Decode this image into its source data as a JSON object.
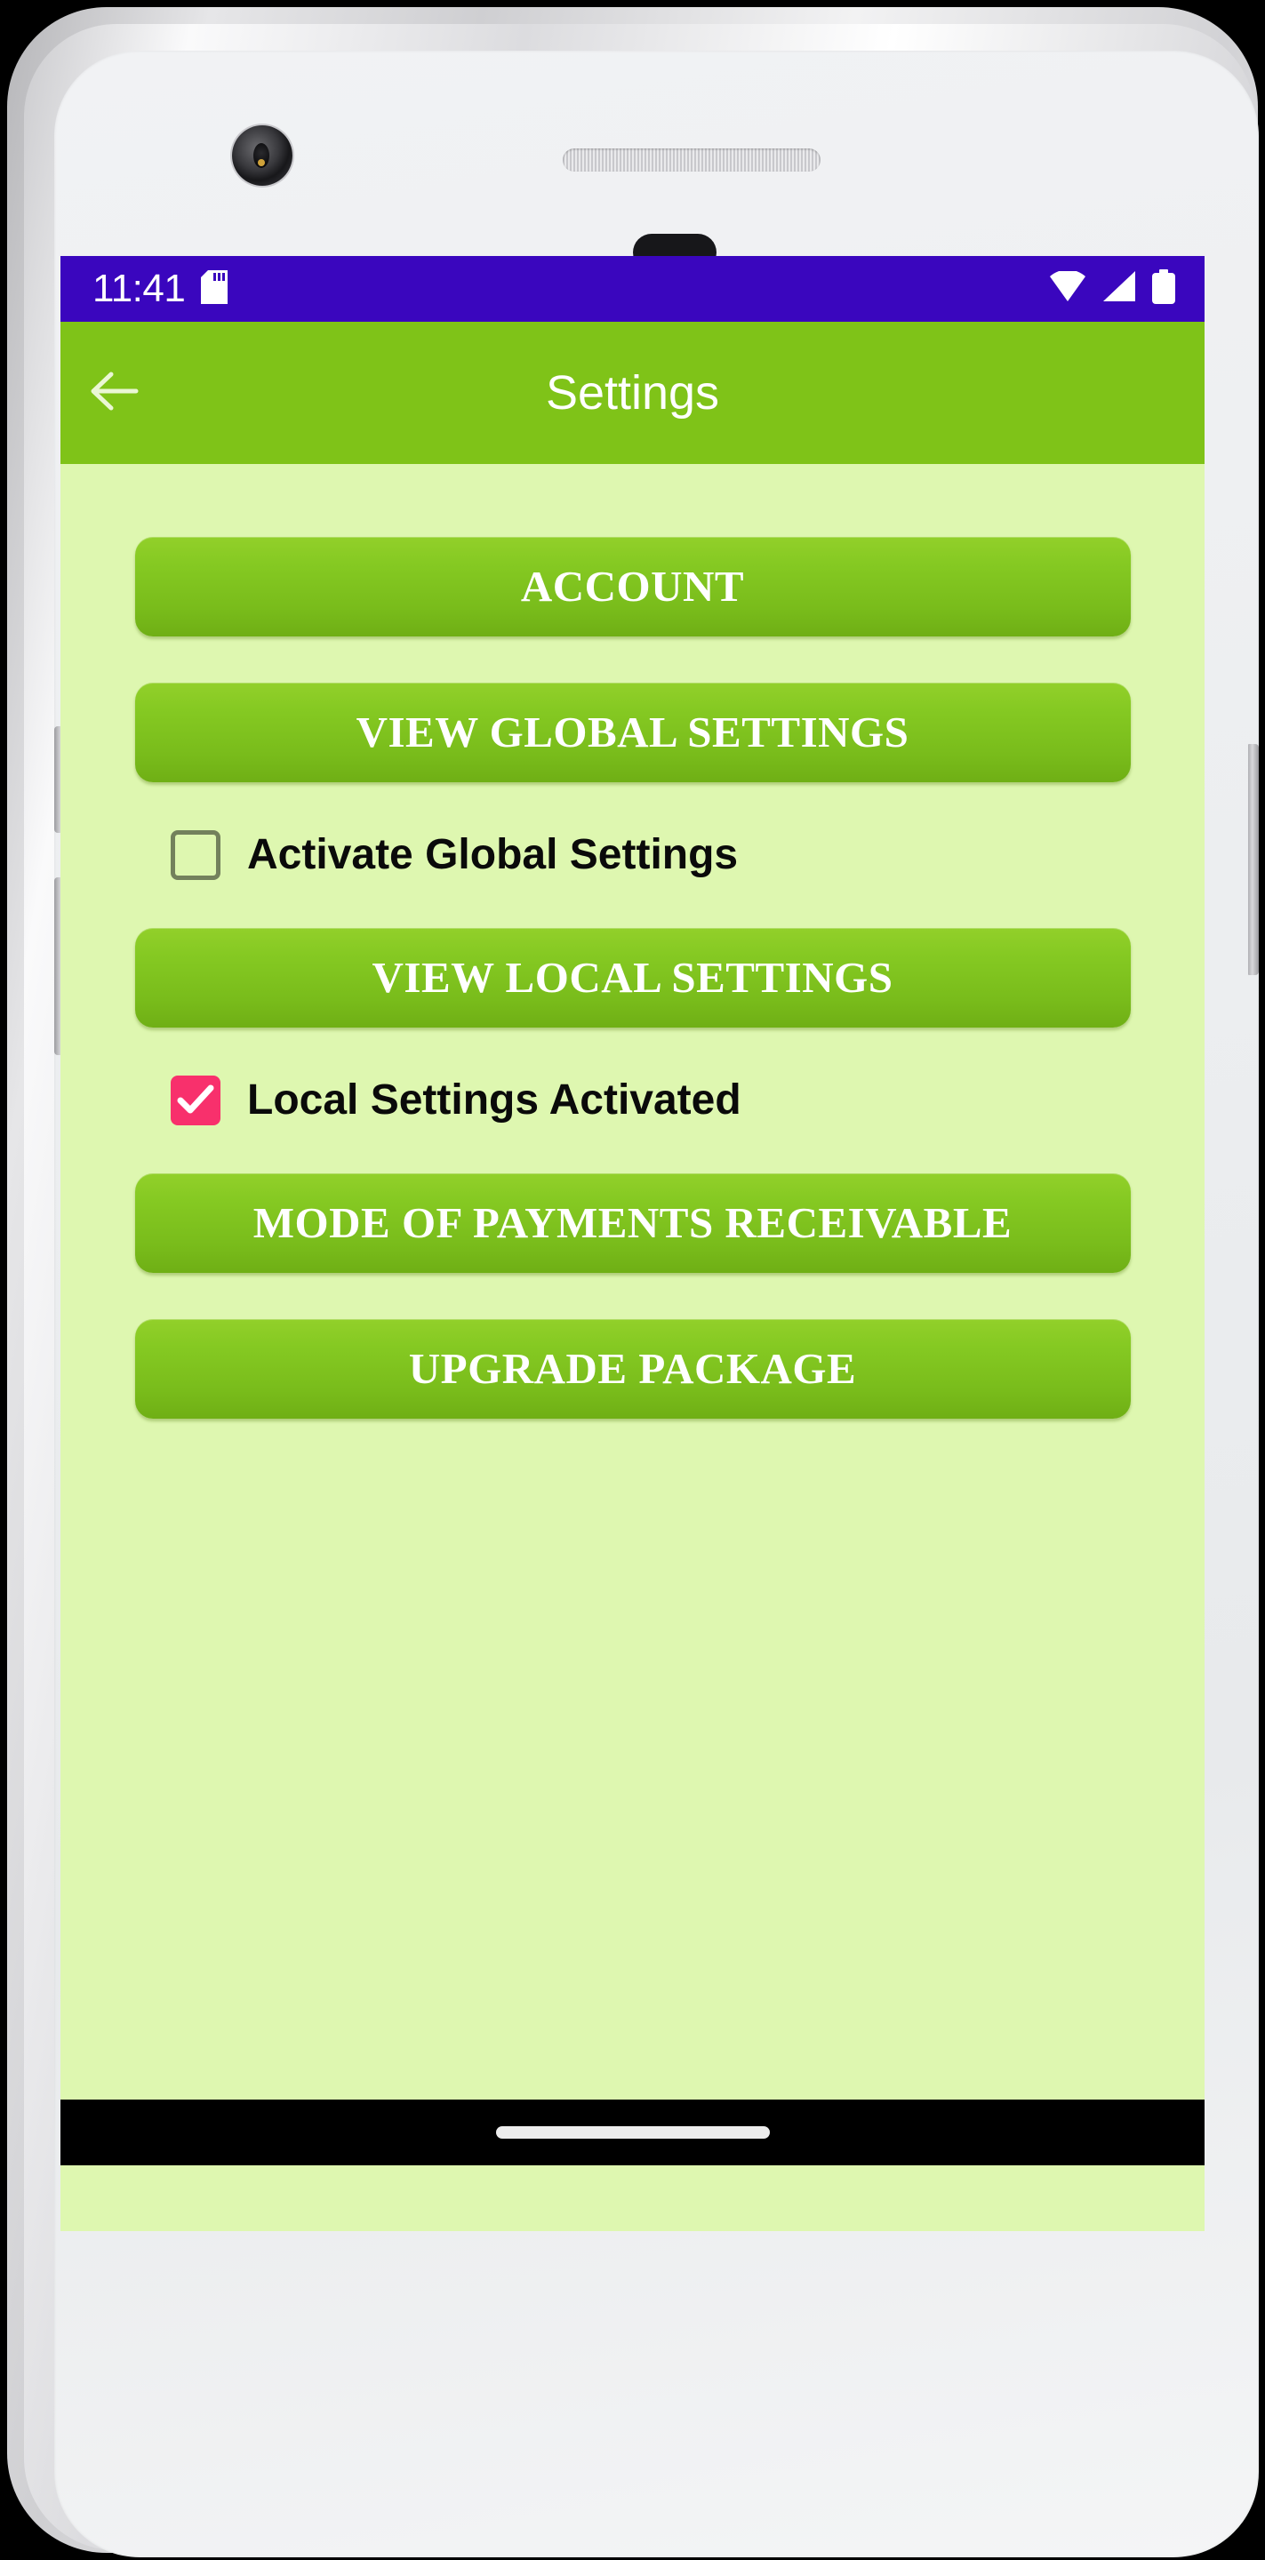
{
  "status_bar": {
    "time": "11:41",
    "icons": [
      "sd-card-icon",
      "wifi-icon",
      "cellular-signal-icon",
      "battery-icon"
    ],
    "background_color": "#3A06BE"
  },
  "app_bar": {
    "title": "Settings",
    "back_icon": "arrow-left-icon",
    "background_color": "#7FC318",
    "text_color": "#FFFFFF"
  },
  "screen": {
    "background_color": "#DEF7B0"
  },
  "content": {
    "buttons": [
      {
        "label": "ACCOUNT"
      },
      {
        "label": "VIEW GLOBAL SETTINGS"
      },
      {
        "label": "VIEW LOCAL SETTINGS"
      },
      {
        "label": "MODE OF PAYMENTS RECEIVABLE"
      },
      {
        "label": "UPGRADE PACKAGE"
      }
    ],
    "checkboxes": [
      {
        "label": "Activate Global Settings",
        "checked": false,
        "border_color": "#73815C"
      },
      {
        "label": "Local Settings Activated",
        "checked": true,
        "fill_color": "#F8306C"
      }
    ],
    "button_gradient_top": "#92D02A",
    "button_gradient_bottom": "#6FAF15",
    "button_text_color": "#FFFFFF"
  },
  "nav_bar": {
    "gesture_handle": "home-gesture-pill",
    "background_color": "#000000"
  }
}
